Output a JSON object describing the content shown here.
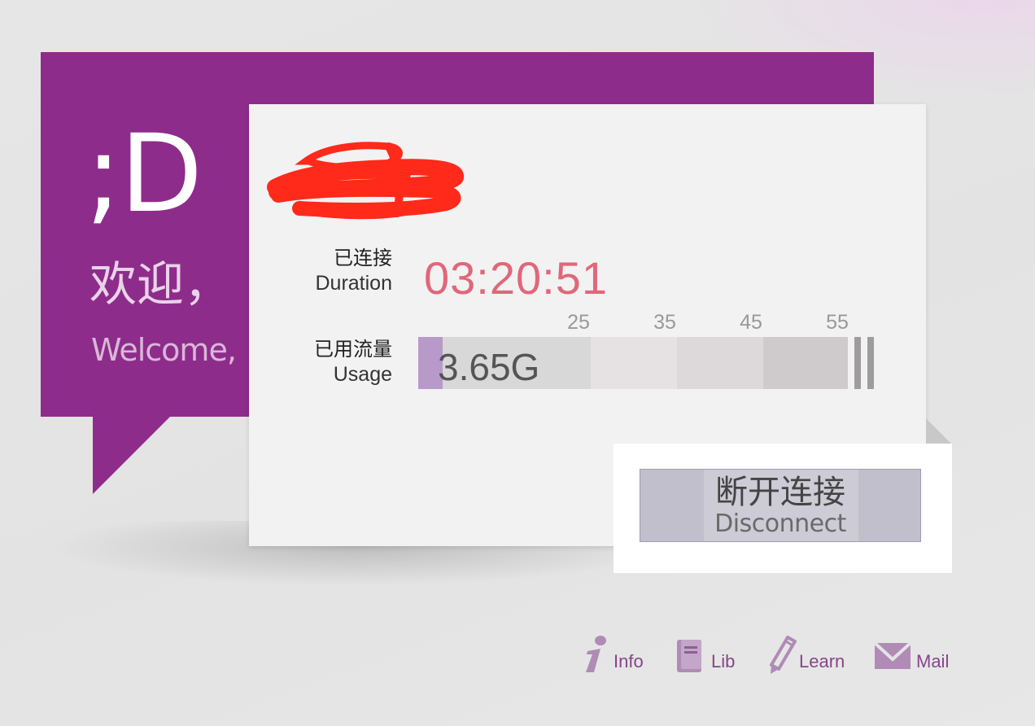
{
  "welcome": {
    "emoticon": ";D",
    "greeting_zh": "欢迎，",
    "greeting_en": "Welcome,"
  },
  "session": {
    "duration_label_zh": "已连接",
    "duration_label_en": "Duration",
    "duration_value": "03:20:51",
    "usage_label_zh": "已用流量",
    "usage_label_en": "Usage",
    "usage_value": "3.65G",
    "usage_fraction": 0.0566,
    "usage_ticks": [
      "25",
      "35",
      "45",
      "55"
    ]
  },
  "actions": {
    "disconnect_zh": "断开连接",
    "disconnect_en": "Disconnect"
  },
  "footer": {
    "info_label": "Info",
    "lib_label": "Lib",
    "learn_label": "Learn",
    "mail_label": "Mail"
  },
  "icons": {
    "info": "info-icon",
    "lib": "book-icon",
    "learn": "pencil-icon",
    "mail": "mail-icon"
  },
  "colors": {
    "brand_purple": "#8e2c8b",
    "duration_text": "#e0677a",
    "usage_fill": "#b79ac9",
    "link_purple": "#86458a",
    "redaction_red": "#ff2a1a"
  }
}
